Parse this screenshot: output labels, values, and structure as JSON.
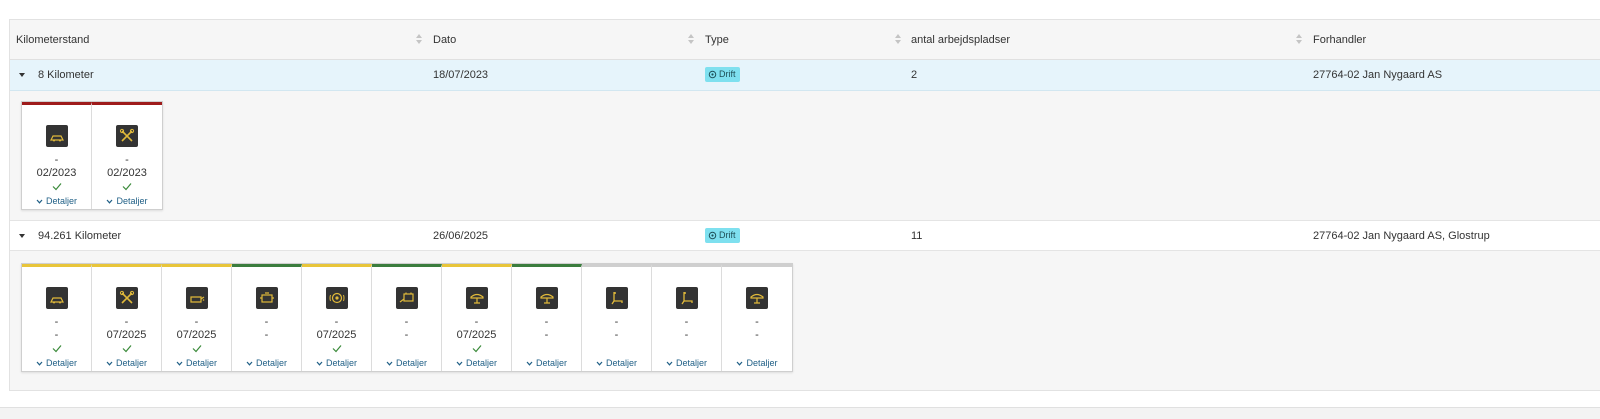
{
  "colors": {
    "red": "#9e1b1b",
    "yellow": "#e8c53a",
    "green": "#3b7d3e",
    "gray": "#cfcfcf",
    "badge": "#7ee0ef",
    "link": "#1f5f86",
    "check": "#3a8a3a",
    "icon_stroke": "#e0b93a"
  },
  "header": {
    "columns": [
      {
        "label": "Kilometerstand"
      },
      {
        "label": "Dato"
      },
      {
        "label": "Type"
      },
      {
        "label": "antal arbejdspladser"
      },
      {
        "label": "Forhandler"
      }
    ]
  },
  "rows": [
    {
      "kilometer": "8 Kilometer",
      "dato": "18/07/2023",
      "type": "Drift",
      "antal": "2",
      "forhandler": "27764-02 Jan Nygaard AS"
    },
    {
      "kilometer": "94.261 Kilometer",
      "dato": "26/06/2025",
      "type": "Drift",
      "antal": "11",
      "forhandler": "27764-02 Jan Nygaard AS, Glostrup"
    }
  ],
  "cards1": [
    {
      "icon": "car-icon",
      "color": "red",
      "line1": "-",
      "line2": "02/2023",
      "checked": true,
      "details": "Detaljer"
    },
    {
      "icon": "tools-icon",
      "color": "red",
      "line1": "-",
      "line2": "02/2023",
      "checked": true,
      "details": "Detaljer"
    }
  ],
  "cards2": [
    {
      "icon": "car-icon",
      "color": "yellow",
      "line1": "-",
      "line2": "-",
      "checked": true,
      "details": "Detaljer"
    },
    {
      "icon": "tools-icon",
      "color": "yellow",
      "line1": "-",
      "line2": "07/2025",
      "checked": true,
      "details": "Detaljer"
    },
    {
      "icon": "oil-can-icon",
      "color": "yellow",
      "line1": "-",
      "line2": "07/2025",
      "checked": true,
      "details": "Detaljer"
    },
    {
      "icon": "engine-icon",
      "color": "green",
      "line1": "-",
      "line2": "-",
      "checked": false,
      "details": "Detaljer"
    },
    {
      "icon": "brake-icon",
      "color": "yellow",
      "line1": "-",
      "line2": "07/2025",
      "checked": true,
      "details": "Detaljer"
    },
    {
      "icon": "battery-icon",
      "color": "green",
      "line1": "-",
      "line2": "-",
      "checked": false,
      "details": "Detaljer"
    },
    {
      "icon": "wiper-icon",
      "color": "yellow",
      "line1": "-",
      "line2": "07/2025",
      "checked": true,
      "details": "Detaljer"
    },
    {
      "icon": "wiper-icon",
      "color": "green",
      "line1": "-",
      "line2": "-",
      "checked": false,
      "details": "Detaljer"
    },
    {
      "icon": "seat-icon",
      "color": "gray",
      "line1": "-",
      "line2": "-",
      "checked": false,
      "details": "Detaljer"
    },
    {
      "icon": "seat-icon",
      "color": "gray",
      "line1": "-",
      "line2": "-",
      "checked": false,
      "details": "Detaljer"
    },
    {
      "icon": "wiper-icon",
      "color": "gray",
      "line1": "-",
      "line2": "-",
      "checked": false,
      "details": "Detaljer"
    }
  ]
}
